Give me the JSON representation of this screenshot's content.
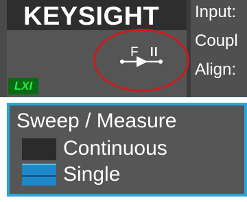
{
  "header": {
    "logo_text": "KEYSIGHT",
    "lxi_badge": "LXI",
    "info_lines": [
      "Input:",
      "Coupl",
      "Align:"
    ]
  },
  "trigger": {
    "icon": "free-run-trigger-icon",
    "label": "F",
    "annotation": "red-circle-highlight"
  },
  "sweep_measure": {
    "title": "Sweep / Measure",
    "options": [
      {
        "label": "Continuous",
        "selected": false
      },
      {
        "label": "Single",
        "selected": true
      }
    ]
  },
  "colors": {
    "accent_blue": "#27a6de",
    "highlight_red": "#c91c1c",
    "lxi_green": "#2fe64b"
  }
}
